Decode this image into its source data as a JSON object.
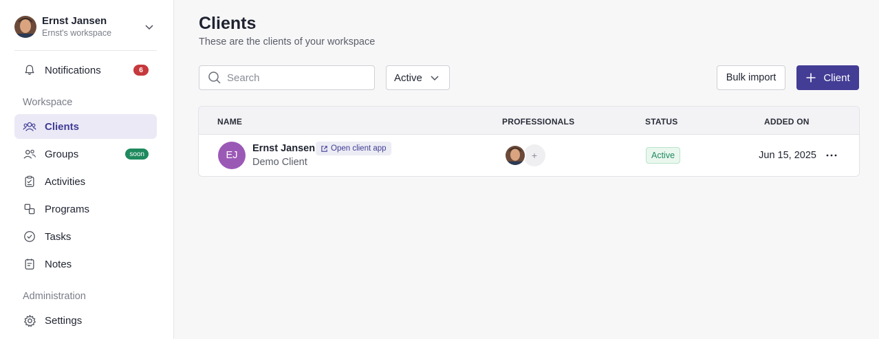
{
  "workspace": {
    "user_name": "Ernst Jansen",
    "workspace_name": "Ernst's workspace"
  },
  "sidebar": {
    "notifications": {
      "label": "Notifications",
      "badge": "6",
      "icon": "bell-icon"
    },
    "workspace_section": "Workspace",
    "items": [
      {
        "label": "Clients",
        "icon": "users-icon",
        "active": true
      },
      {
        "label": "Groups",
        "icon": "group-icon",
        "badge": "soon"
      },
      {
        "label": "Activities",
        "icon": "clipboard-icon"
      },
      {
        "label": "Programs",
        "icon": "programs-icon"
      },
      {
        "label": "Tasks",
        "icon": "check-circle-icon"
      },
      {
        "label": "Notes",
        "icon": "notes-icon"
      }
    ],
    "admin_section": "Administration",
    "settings": {
      "label": "Settings",
      "icon": "gear-icon"
    }
  },
  "main": {
    "title": "Clients",
    "subtitle": "These are the clients of your workspace",
    "search_placeholder": "Search",
    "status_filter": "Active",
    "bulk_import_label": "Bulk import",
    "add_client_label": "Client"
  },
  "table": {
    "columns": [
      "NAME",
      "PROFESSIONALS",
      "STATUS",
      "ADDED ON"
    ],
    "rows": [
      {
        "initials": "EJ",
        "name": "Ernst Jansen",
        "open_app_label": "Open client app",
        "subtitle": "Demo Client",
        "add_professional": "+",
        "status": "Active",
        "added_on": "Jun 15, 2025"
      }
    ]
  },
  "colors": {
    "accent": "#433d95",
    "danger_badge": "#c6393c",
    "soon_badge": "#1f8a5e",
    "client_avatar": "#9b59b6"
  }
}
